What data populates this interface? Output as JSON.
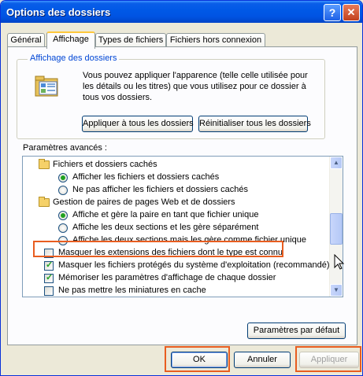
{
  "window": {
    "title": "Options des dossiers",
    "help_label": "?",
    "close_label": "✕"
  },
  "tabs": [
    {
      "label": "Général"
    },
    {
      "label": "Affichage",
      "active": true
    },
    {
      "label": "Types de fichiers"
    },
    {
      "label": "Fichiers hors connexion"
    }
  ],
  "folder_views": {
    "legend": "Affichage des dossiers",
    "description": "Vous pouvez appliquer l'apparence (telle celle utilisée pour les détails ou les titres) que vous utilisez pour ce dossier à tous vos dossiers.",
    "apply_all_label": "Appliquer à tous les dossiers",
    "reset_all_label": "Réinitialiser tous les dossiers"
  },
  "advanced": {
    "label": "Paramètres avancés :",
    "items": [
      {
        "type": "folder",
        "label": "Fichiers et dossiers cachés"
      },
      {
        "type": "radio",
        "checked": true,
        "label": "Afficher les fichiers et dossiers cachés"
      },
      {
        "type": "radio",
        "checked": false,
        "label": "Ne pas afficher les fichiers et dossiers cachés"
      },
      {
        "type": "folder",
        "label": "Gestion de paires de pages Web et de dossiers"
      },
      {
        "type": "radio",
        "checked": true,
        "label": "Affiche et gère la paire en tant que fichier unique"
      },
      {
        "type": "radio",
        "checked": false,
        "label": "Affiche les deux sections et les gère séparément"
      },
      {
        "type": "radio",
        "checked": false,
        "label": "Affiche les deux sections mais les gère comme fichier unique"
      },
      {
        "type": "checkbox",
        "checked": false,
        "label": "Masquer les extensions des fichiers dont le type est connu"
      },
      {
        "type": "checkbox",
        "checked": true,
        "label": "Masquer les fichiers protégés du système d'exploitation (recommandé)"
      },
      {
        "type": "checkbox",
        "checked": true,
        "label": "Mémoriser les paramètres d'affichage de chaque dossier"
      },
      {
        "type": "checkbox",
        "checked": false,
        "label": "Ne pas mettre les miniatures en cache"
      }
    ],
    "defaults_label": "Paramètres par défaut"
  },
  "footer": {
    "ok_label": "OK",
    "cancel_label": "Annuler",
    "apply_label": "Appliquer"
  },
  "colors": {
    "highlight": "#e85d20",
    "titlebar": "#0054e3",
    "legend": "#0046d5"
  }
}
